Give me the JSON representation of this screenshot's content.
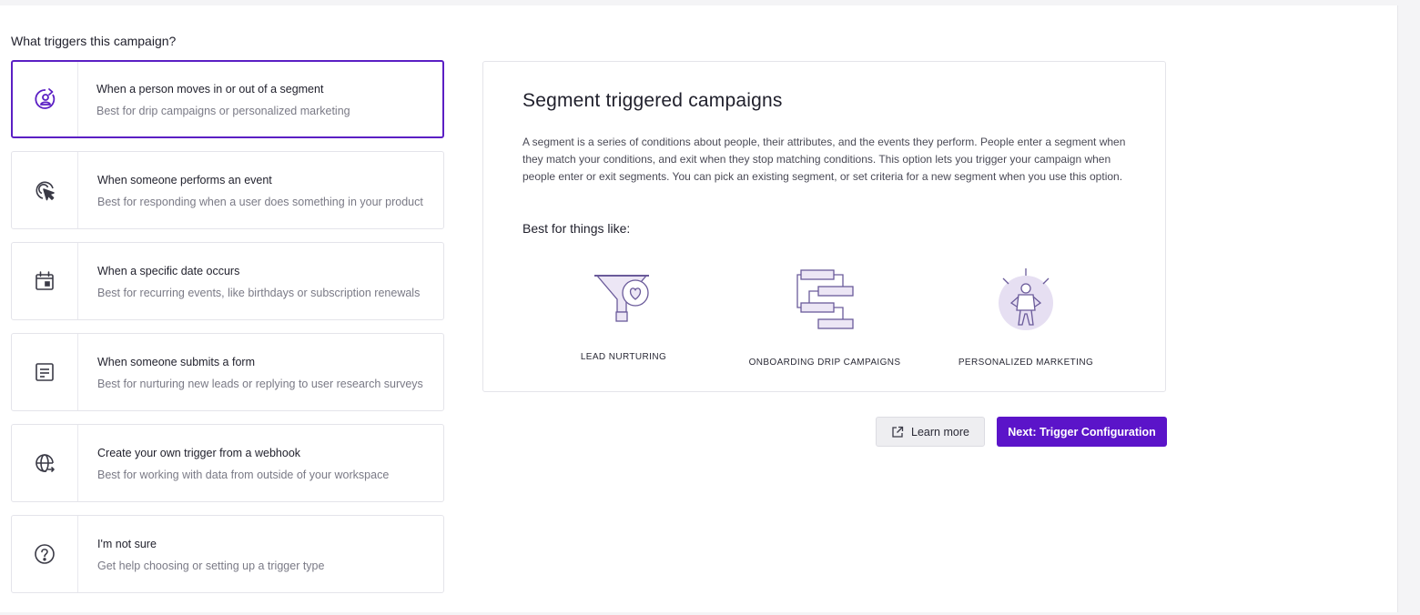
{
  "question": "What triggers this campaign?",
  "options": [
    {
      "title": "When a person moves in or out of a segment",
      "description": "Best for drip campaigns or personalized marketing",
      "icon": "segment-person-icon",
      "selected": true
    },
    {
      "title": "When someone performs an event",
      "description": "Best for responding when a user does something in your product",
      "icon": "cursor-click-icon",
      "selected": false
    },
    {
      "title": "When a specific date occurs",
      "description": "Best for recurring events, like birthdays or subscription renewals",
      "icon": "calendar-icon",
      "selected": false
    },
    {
      "title": "When someone submits a form",
      "description": "Best for nurturing new leads or replying to user research surveys",
      "icon": "form-icon",
      "selected": false
    },
    {
      "title": "Create your own trigger from a webhook",
      "description": "Best for working with data from outside of your workspace",
      "icon": "globe-webhook-icon",
      "selected": false
    },
    {
      "title": "I'm not sure",
      "description": "Get help choosing or setting up a trigger type",
      "icon": "question-circle-icon",
      "selected": false
    }
  ],
  "panel": {
    "title": "Segment triggered campaigns",
    "body": "A segment is a series of conditions about people, their attributes, and the events they perform. People enter a segment when they match your conditions, and exit when they stop matching conditions. This option lets you trigger your campaign when people enter or exit segments. You can pick an existing segment, or set criteria for a new segment when you use this option.",
    "best_for": "Best for things like:",
    "examples": [
      {
        "label": "LEAD NURTURING",
        "icon": "funnel-heart-icon"
      },
      {
        "label": "ONBOARDING DRIP CAMPAIGNS",
        "icon": "flowchart-icon"
      },
      {
        "label": "PERSONALIZED MARKETING",
        "icon": "person-spotlight-icon"
      }
    ]
  },
  "actions": {
    "learn_more": "Learn more",
    "next": "Next: Trigger Configuration"
  },
  "colors": {
    "accent": "#5b14c9",
    "selected_border": "#5b1fc4",
    "illustration_stroke": "#6a5a9a",
    "illustration_fill": "#e6dff2"
  }
}
